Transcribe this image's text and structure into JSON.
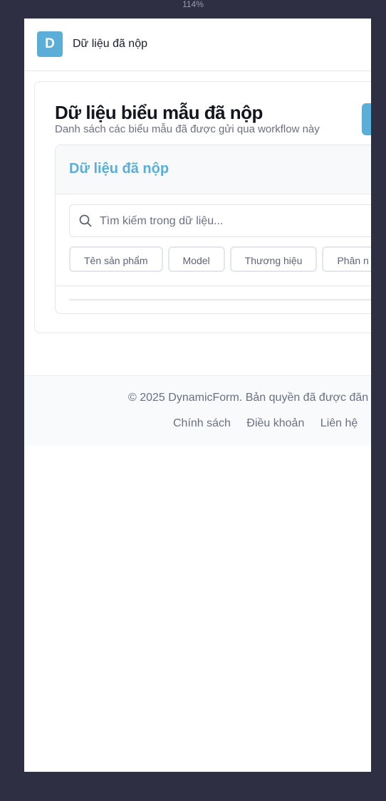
{
  "zoom_level": "114%",
  "header": {
    "logo_letter": "D",
    "title": "Dữ liệu đã nộp"
  },
  "card": {
    "title": "Dữ liệu biểu mẫu đã nộp",
    "subtitle": "Danh sách các biểu mẫu đã được gửi qua workflow này"
  },
  "panel": {
    "title": "Dữ liệu đã nộp",
    "search_placeholder": "Tìm kiếm trong dữ liệu...",
    "columns": [
      "Tên sản phẩm",
      "Model",
      "Thương hiệu",
      "Phân n"
    ]
  },
  "footer": {
    "copyright": "© 2025 DynamicForm. Bản quyền đã được đăn",
    "links": [
      "Chính sách",
      "Điều khoản",
      "Liên hệ"
    ]
  },
  "colors": {
    "accent": "#5aaed8",
    "background": "#2e2f42"
  }
}
